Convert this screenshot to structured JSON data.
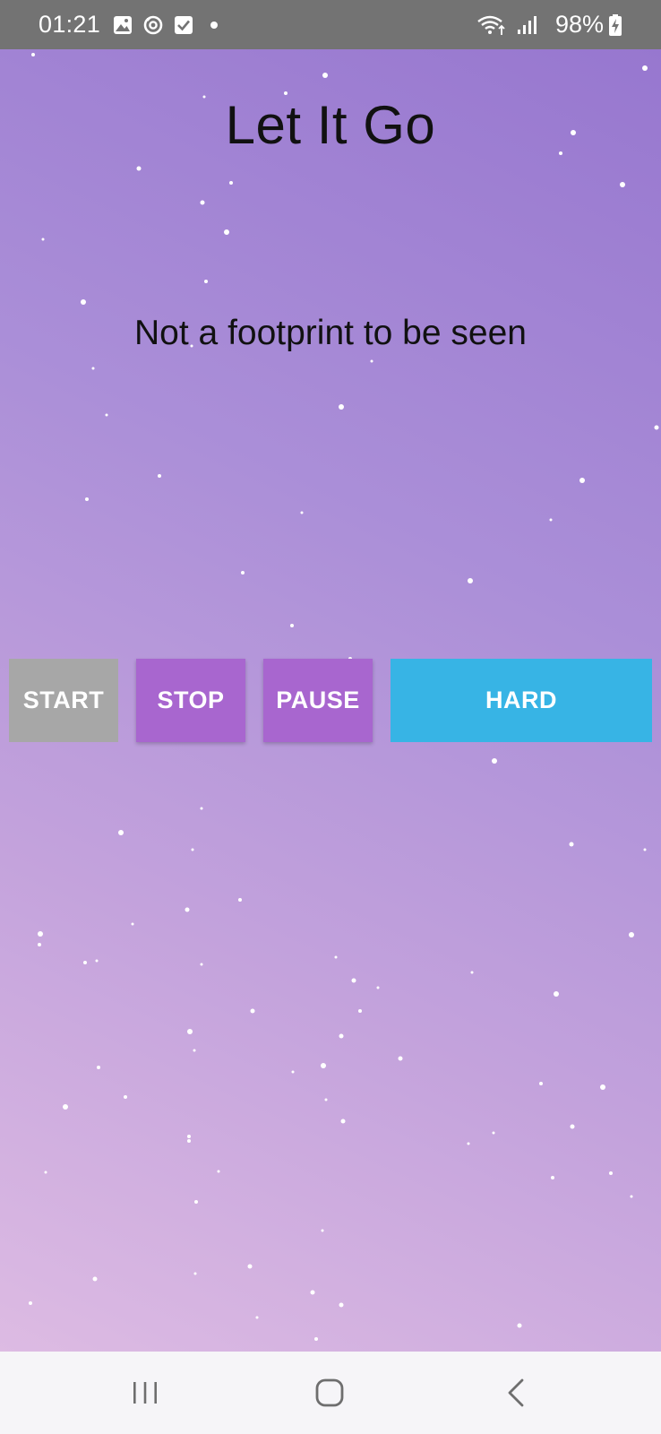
{
  "status_bar": {
    "time": "01:21",
    "battery": "98%",
    "icons": [
      "gallery-icon",
      "sync-icon",
      "checkbox-icon",
      "notification-dot",
      "wifi-icon",
      "signal-icon",
      "battery-charging-icon"
    ]
  },
  "app": {
    "title": "Let It Go",
    "subtitle": "Not a footprint to be seen",
    "buttons": {
      "start": "START",
      "stop": "STOP",
      "pause": "PAUSE",
      "hard": "HARD"
    }
  },
  "colors": {
    "status_bar": "#737373",
    "gradient_top": "#9777cf",
    "gradient_bottom": "#ddbbe3",
    "start_button": "#a7a7a7",
    "stop_pause_button": "#a866cf",
    "hard_button": "#37b4e5",
    "nav_bar": "#f6f5f8"
  },
  "nav_bar": {
    "icons": [
      "recent-apps-icon",
      "home-icon",
      "back-icon"
    ]
  }
}
